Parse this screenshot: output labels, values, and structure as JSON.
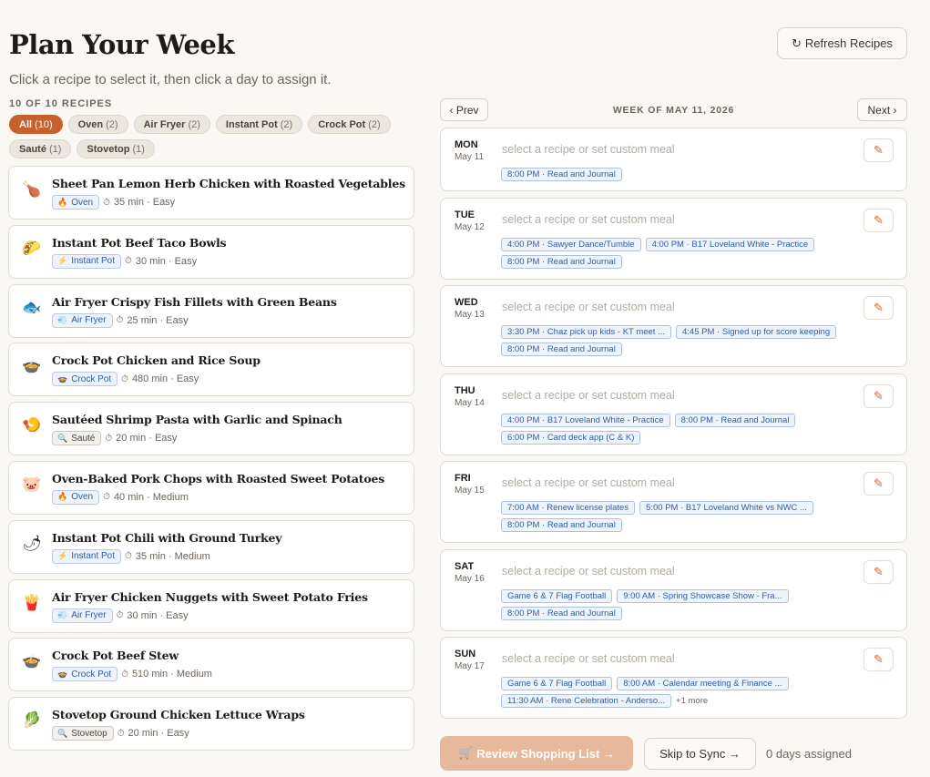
{
  "header": {
    "title": "Plan Your Week",
    "subtitle": "Click a recipe to select it, then click a day to assign it.",
    "refresh_icon": "↻",
    "refresh_label": "Refresh Recipes"
  },
  "recipes_count": "10 OF 10 RECIPES",
  "filters": [
    {
      "label": "All",
      "count": "(10)",
      "active": true
    },
    {
      "label": "Oven",
      "count": "(2)",
      "active": false
    },
    {
      "label": "Air Fryer",
      "count": "(2)",
      "active": false
    },
    {
      "label": "Instant Pot",
      "count": "(2)",
      "active": false
    },
    {
      "label": "Crock Pot",
      "count": "(2)",
      "active": false
    },
    {
      "label": "Sauté",
      "count": "(1)",
      "active": false
    },
    {
      "label": "Stovetop",
      "count": "(1)",
      "active": false
    }
  ],
  "recipes": [
    {
      "name": "Sheet Pan Lemon Herb Chicken with Roasted Vegetables",
      "icon": "🍗",
      "icon_name": "chicken-leg-icon",
      "method": "Oven",
      "method_icon": "🔥",
      "method_class": "oven",
      "meta": "35 min · Easy"
    },
    {
      "name": "Instant Pot Beef Taco Bowls",
      "icon": "🌮",
      "icon_name": "taco-icon",
      "method": "Instant Pot",
      "method_icon": "⚡",
      "method_class": "ip",
      "meta": "30 min · Easy"
    },
    {
      "name": "Air Fryer Crispy Fish Fillets with Green Beans",
      "icon": "🐟",
      "icon_name": "fish-icon",
      "method": "Air Fryer",
      "method_icon": "💨",
      "method_class": "af",
      "meta": "25 min · Easy"
    },
    {
      "name": "Crock Pot Chicken and Rice Soup",
      "icon": "🍲",
      "icon_name": "pot-icon",
      "method": "Crock Pot",
      "method_icon": "🍲",
      "method_class": "cp",
      "meta": "480 min · Easy"
    },
    {
      "name": "Sautéed Shrimp Pasta with Garlic and Spinach",
      "icon": "🍤",
      "icon_name": "shrimp-icon",
      "method": "Sauté",
      "method_icon": "🔍",
      "method_class": "saute",
      "meta": "20 min · Easy"
    },
    {
      "name": "Oven-Baked Pork Chops with Roasted Sweet Potatoes",
      "icon": "🐷",
      "icon_name": "pig-icon",
      "method": "Oven",
      "method_icon": "🔥",
      "method_class": "oven",
      "meta": "40 min · Medium"
    },
    {
      "name": "Instant Pot Chili with Ground Turkey",
      "icon": "🌶",
      "icon_name": "chili-pepper-icon",
      "method": "Instant Pot",
      "method_icon": "⚡",
      "method_class": "ip",
      "meta": "35 min · Medium"
    },
    {
      "name": "Air Fryer Chicken Nuggets with Sweet Potato Fries",
      "icon": "🍟",
      "icon_name": "fries-icon",
      "method": "Air Fryer",
      "method_icon": "💨",
      "method_class": "af",
      "meta": "30 min · Easy"
    },
    {
      "name": "Crock Pot Beef Stew",
      "icon": "🍲",
      "icon_name": "pot-icon",
      "method": "Crock Pot",
      "method_icon": "🍲",
      "method_class": "cp",
      "meta": "510 min · Medium"
    },
    {
      "name": "Stovetop Ground Chicken Lettuce Wraps",
      "icon": "🥬",
      "icon_name": "lettuce-icon",
      "method": "Stovetop",
      "method_icon": "🔍",
      "method_class": "stovetop",
      "meta": "20 min · Easy"
    }
  ],
  "week": {
    "prev_label": "‹ Prev",
    "next_label": "Next ›",
    "label": "WEEK OF MAY 11, 2026"
  },
  "days": [
    {
      "name": "MON",
      "date": "May 11",
      "placeholder": "select a recipe or set custom meal",
      "events": [
        "8:00 PM · Read and Journal"
      ],
      "more": ""
    },
    {
      "name": "TUE",
      "date": "May 12",
      "placeholder": "select a recipe or set custom meal",
      "events": [
        "4:00 PM · Sawyer Dance/Tumble",
        "4:00 PM · B17 Loveland White - Practice",
        "8:00 PM · Read and Journal"
      ],
      "more": ""
    },
    {
      "name": "WED",
      "date": "May 13",
      "placeholder": "select a recipe or set custom meal",
      "events": [
        "3:30 PM · Chaz pick up kids - KT meet ...",
        "4:45 PM · Signed up for score keeping",
        "8:00 PM · Read and Journal"
      ],
      "more": ""
    },
    {
      "name": "THU",
      "date": "May 14",
      "placeholder": "select a recipe or set custom meal",
      "events": [
        "4:00 PM · B17 Loveland White - Practice",
        "8:00 PM · Read and Journal",
        "6:00 PM · Card deck app (C & K)"
      ],
      "more": ""
    },
    {
      "name": "FRI",
      "date": "May 15",
      "placeholder": "select a recipe or set custom meal",
      "events": [
        "7:00 AM · Renew license plates",
        "5:00 PM · B17 Loveland White vs NWC ...",
        "8:00 PM · Read and Journal"
      ],
      "more": ""
    },
    {
      "name": "SAT",
      "date": "May 16",
      "placeholder": "select a recipe or set custom meal",
      "events": [
        "Game 6 & 7 Flag Football",
        "9:00 AM · Spring Showcase Show - Fra...",
        "8:00 PM · Read and Journal"
      ],
      "more": ""
    },
    {
      "name": "SUN",
      "date": "May 17",
      "placeholder": "select a recipe or set custom meal",
      "events": [
        "Game 6 & 7 Flag Football",
        "8:00 AM · Calendar meeting & Finance ...",
        "11:30 AM · Rene Celebration - Anderso..."
      ],
      "more": "+1 more"
    }
  ],
  "footer": {
    "review_icon": "🛒",
    "review_label": "Review Shopping List →",
    "skip_label": "Skip to Sync →",
    "assigned_text": "0 days assigned"
  },
  "colors": {
    "accent": "#c8602d",
    "review_button": "#e8b89d",
    "event_blue": "#2d5ea8",
    "edit_orange": "#e0622d"
  }
}
